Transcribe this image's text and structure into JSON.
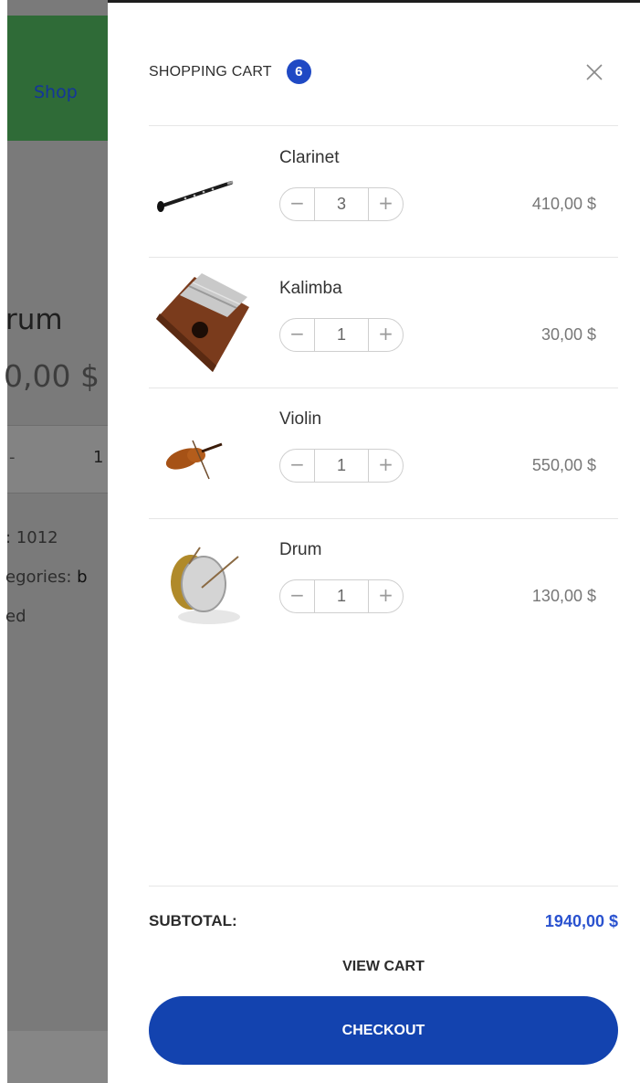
{
  "background_page": {
    "nav_link": "Shop",
    "product_title_fragment": "rum",
    "product_price_fragment": "0,00 $",
    "qty_minus_fragment": "-",
    "qty_value": "1",
    "sku_fragment": ": 1012",
    "categories_fragment": "egories: ",
    "categories_value_fragment": "b",
    "tag_fragment": "ed"
  },
  "cart": {
    "title": "SHOPPING CART",
    "count": "6",
    "close_icon": "close-icon",
    "items": [
      {
        "name": "Clarinet",
        "qty": "3",
        "price": "410,00 $",
        "image": "clarinet-image"
      },
      {
        "name": "Kalimba",
        "qty": "1",
        "price": "30,00 $",
        "image": "kalimba-image"
      },
      {
        "name": "Violin",
        "qty": "1",
        "price": "550,00 $",
        "image": "violin-image"
      },
      {
        "name": "Drum",
        "qty": "1",
        "price": "130,00 $",
        "image": "drum-image"
      }
    ],
    "qty_minus": "−",
    "qty_plus": "+",
    "subtotal_label": "SUBTOTAL:",
    "subtotal_value": "1940,00 $",
    "view_cart_label": "VIEW CART",
    "checkout_label": "CHECKOUT"
  },
  "colors": {
    "badge": "#1f49c4",
    "subtotal": "#2a52cf",
    "checkout": "#1343af",
    "nav_bar": "#2f6b37",
    "overlay": "#7a7a7a"
  }
}
